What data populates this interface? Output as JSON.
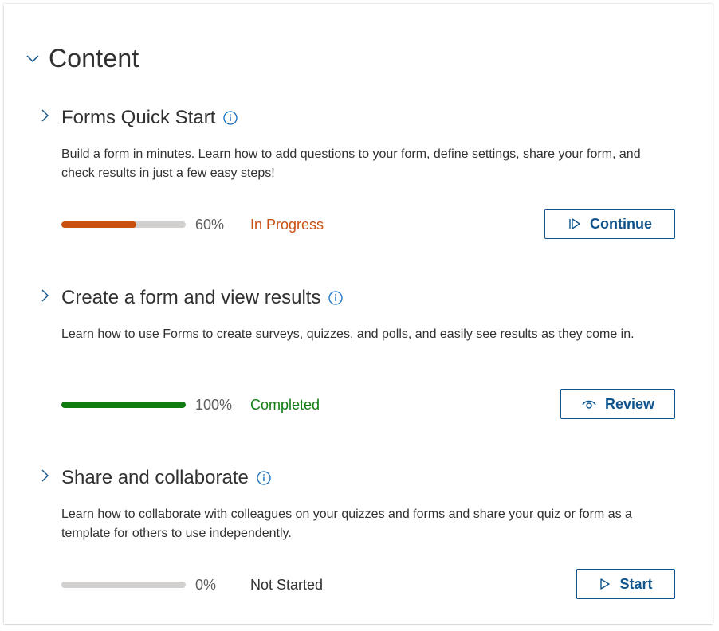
{
  "section": {
    "title": "Content",
    "chevron_icon": "chevron-down-icon"
  },
  "colors": {
    "in_progress": "#ca5010",
    "completed": "#107c10",
    "not_started": "#323130",
    "button_accent": "#0f548c",
    "info_icon": "#0f6cbd"
  },
  "modules": [
    {
      "title": "Forms Quick Start",
      "description": "Build a form in minutes. Learn how to add questions to your form, define settings, share your form, and check results in just a few easy steps!",
      "progress_pct": 60,
      "progress_label": "60%",
      "status": "In Progress",
      "button_label": "Continue",
      "button_icon": "continue-icon"
    },
    {
      "title": "Create a form and view results",
      "description": "Learn how to use Forms to create surveys, quizzes, and polls, and easily see results as they come in.",
      "progress_pct": 100,
      "progress_label": "100%",
      "status": "Completed",
      "button_label": "Review",
      "button_icon": "eye-icon"
    },
    {
      "title": "Share and collaborate",
      "description": "Learn how to collaborate with colleagues on your quizzes and forms and share your quiz or form as a template for others to use independently.",
      "progress_pct": 0,
      "progress_label": "0%",
      "status": "Not Started",
      "button_label": "Start",
      "button_icon": "play-icon"
    }
  ]
}
